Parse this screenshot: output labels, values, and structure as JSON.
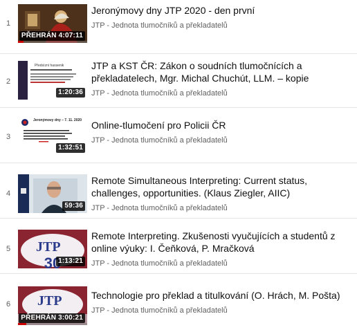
{
  "playlist": {
    "items": [
      {
        "index": "1",
        "title": "Jeronýmovy dny JTP 2020 - den první",
        "channel": "JTP - Jednota tlumočníků a překladatelů",
        "badge": "PŘEHRÁN 4:07:11",
        "watched_progress": 0.08
      },
      {
        "index": "2",
        "title": "JTP a KST ČR: Zákon o soudních tlumočnících a překladatelech, Mgr. Michal Chuchút, LLM. – kopie",
        "channel": "JTP - Jednota tlumočníků a překladatelů",
        "badge": "1:20:36"
      },
      {
        "index": "3",
        "title": "Online-tlumočení pro Policii ČR",
        "channel": "JTP - Jednota tlumočníků a překladatelů",
        "badge": "1:32:51"
      },
      {
        "index": "4",
        "title": "Remote Simultaneous Interpreting: Current status, challenges, opportunities. (Klaus Ziegler, AIIC)",
        "channel": "JTP - Jednota tlumočníků a překladatelů",
        "badge": "59:36"
      },
      {
        "index": "5",
        "title": "Remote Interpreting. Zkušenosti vyučujících a studentů z online výuky: I. Čeňková, P. Mračková",
        "channel": "JTP - Jednota tlumočníků a překladatelů",
        "badge": "1:13:21"
      },
      {
        "index": "6",
        "title": "Technologie pro překlad a titulkování (O. Hrách, M. Pošta)",
        "channel": "JTP - Jednota tlumočníků a překladatelů",
        "badge": "PŘEHRÁN 3:00:21",
        "watched_progress": 0.12
      }
    ],
    "thumbnail_text": {
      "slide2_heading": "Předsíznì hassenik",
      "slide3_heading": "Jeronýmovy dny – 7. 11. 2020",
      "logo_text": "JTP",
      "logo_number": "30"
    },
    "colors": {
      "progress": "#cc0000",
      "text_primary": "#0f0f0f",
      "text_secondary": "#606060"
    }
  }
}
